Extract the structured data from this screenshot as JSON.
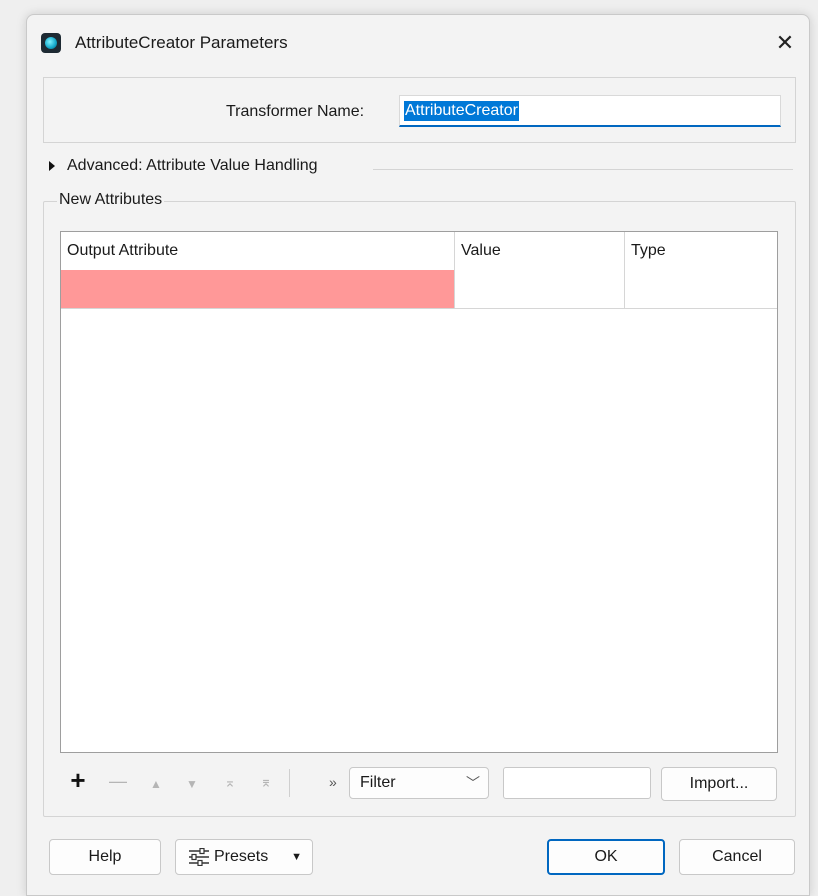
{
  "window": {
    "title": "AttributeCreator Parameters",
    "close_icon": "close-icon",
    "app_icon": "fme-transformer-icon"
  },
  "transformer": {
    "label": "Transformer Name:",
    "value": "AttributeCreator"
  },
  "advanced": {
    "label": "Advanced: Attribute Value Handling",
    "expanded": false
  },
  "new_attributes": {
    "group_label": "New Attributes",
    "columns": [
      "Output Attribute",
      "Value",
      "Type"
    ],
    "rows": [
      {
        "output_attribute": "",
        "value": "",
        "type": "",
        "invalid": true
      }
    ],
    "invalid_color": "#ff9898"
  },
  "toolbar": {
    "add": "+",
    "remove": "—",
    "move_up": "▲",
    "move_down": "▼",
    "move_top": "⌅",
    "move_bottom": "⌆",
    "more": "»",
    "filter_value": "Filter",
    "filter_text": "",
    "import_label": "Import..."
  },
  "footer": {
    "help_label": "Help",
    "presets_label": "Presets",
    "ok_label": "OK",
    "cancel_label": "Cancel"
  },
  "colors": {
    "accent": "#0067c0",
    "selection": "#0078d7"
  }
}
